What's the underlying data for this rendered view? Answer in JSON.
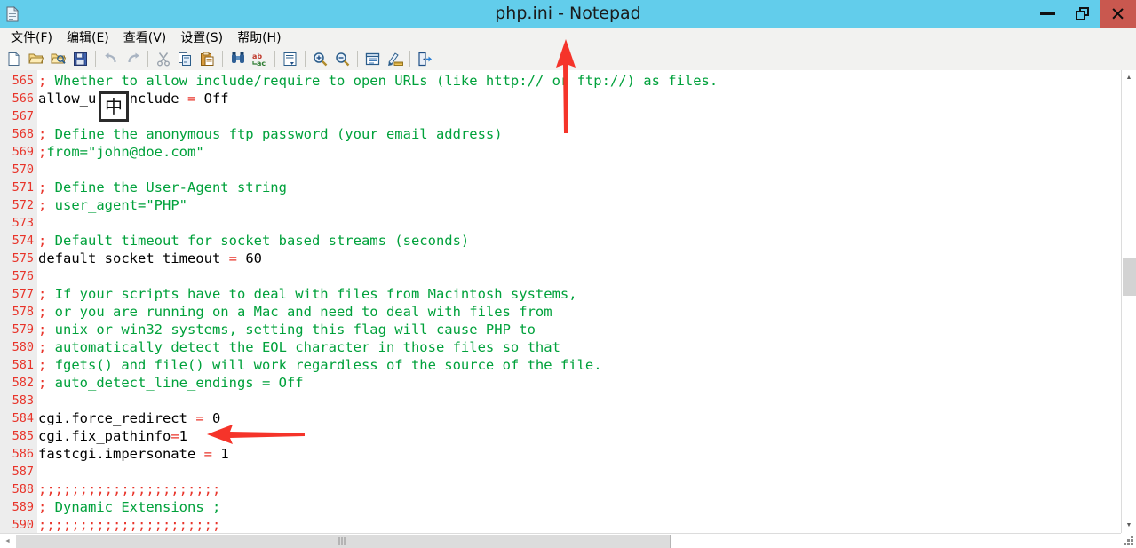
{
  "window": {
    "title": "php.ini - Notepad",
    "app_icon": "notepad-document-icon",
    "controls": {
      "minimize": "Minimize",
      "restore": "Restore",
      "close": "Close",
      "close_glyph": "✕"
    },
    "colors": {
      "titlebar": "#62cdeb",
      "close_button": "#c9584f",
      "chrome": "#f2f2f0",
      "gutter": "#ededed",
      "line_number": "#e8342a",
      "comment": "#00a13b",
      "operator": "#e8342a",
      "text": "#000000",
      "annotation_arrow": "#f5342a"
    }
  },
  "menubar": {
    "items": [
      {
        "label": "文件(F)",
        "name": "menu-file"
      },
      {
        "label": "编辑(E)",
        "name": "menu-edit"
      },
      {
        "label": "查看(V)",
        "name": "menu-view"
      },
      {
        "label": "设置(S)",
        "name": "menu-settings"
      },
      {
        "label": "帮助(H)",
        "name": "menu-help"
      }
    ]
  },
  "toolbar": {
    "buttons": [
      {
        "icon": "new-file-icon",
        "label": "新建"
      },
      {
        "icon": "open-folder-icon",
        "label": "打开"
      },
      {
        "icon": "open-recent-search-icon",
        "label": "浏览"
      },
      {
        "icon": "save-disk-icon",
        "label": "保存"
      },
      {
        "icon": "undo-arrow-icon",
        "label": "撤销"
      },
      {
        "icon": "redo-arrow-icon",
        "label": "重做"
      },
      {
        "icon": "cut-scissors-icon",
        "label": "剪切"
      },
      {
        "icon": "copy-pages-icon",
        "label": "复制"
      },
      {
        "icon": "paste-clipboard-icon",
        "label": "粘贴"
      },
      {
        "icon": "find-binoculars-icon",
        "label": "查找"
      },
      {
        "icon": "replace-abc-icon",
        "label": "替换"
      },
      {
        "icon": "goto-line-icon",
        "label": "转到"
      },
      {
        "icon": "zoom-in-icon",
        "label": "放大"
      },
      {
        "icon": "zoom-out-icon",
        "label": "缩小"
      },
      {
        "icon": "properties-list-icon",
        "label": "属性"
      },
      {
        "icon": "edit-ruler-icon",
        "label": "设置"
      },
      {
        "icon": "exit-door-icon",
        "label": "退出"
      }
    ]
  },
  "ime": {
    "indicator": "中"
  },
  "editor": {
    "first_line_number": 565,
    "lines": [
      {
        "n": "565",
        "semi": ";",
        "comment": " Whether to allow include/require to open URLs (like http:// or ftp://) as files.",
        "kind": "comment"
      },
      {
        "n": "566",
        "key": "allow_url_include",
        "op": " = ",
        "val": "Off",
        "kind": "setting"
      },
      {
        "n": "567",
        "kind": "blank"
      },
      {
        "n": "568",
        "semi": ";",
        "comment": " Define the anonymous ftp password (your email address)",
        "kind": "comment"
      },
      {
        "n": "569",
        "semi": ";",
        "comment": "from=\"john@doe.com\"",
        "kind": "comment"
      },
      {
        "n": "570",
        "kind": "blank"
      },
      {
        "n": "571",
        "semi": ";",
        "comment": " Define the User-Agent string",
        "kind": "comment"
      },
      {
        "n": "572",
        "semi": ";",
        "comment": " user_agent=\"PHP\"",
        "kind": "comment"
      },
      {
        "n": "573",
        "kind": "blank"
      },
      {
        "n": "574",
        "semi": ";",
        "comment": " Default timeout for socket based streams (seconds)",
        "kind": "comment"
      },
      {
        "n": "575",
        "key": "default_socket_timeout",
        "op": " = ",
        "val": "60",
        "kind": "setting"
      },
      {
        "n": "576",
        "kind": "blank"
      },
      {
        "n": "577",
        "semi": ";",
        "comment": " If your scripts have to deal with files from Macintosh systems,",
        "kind": "comment"
      },
      {
        "n": "578",
        "semi": ";",
        "comment": " or you are running on a Mac and need to deal with files from",
        "kind": "comment"
      },
      {
        "n": "579",
        "semi": ";",
        "comment": " unix or win32 systems, setting this flag will cause PHP to",
        "kind": "comment"
      },
      {
        "n": "580",
        "semi": ";",
        "comment": " automatically detect the EOL character in those files so that",
        "kind": "comment"
      },
      {
        "n": "581",
        "semi": ";",
        "comment": " fgets() and file() will work regardless of the source of the file.",
        "kind": "comment"
      },
      {
        "n": "582",
        "semi": ";",
        "comment": " auto_detect_line_endings = Off",
        "kind": "comment"
      },
      {
        "n": "583",
        "kind": "blank"
      },
      {
        "n": "584",
        "key": "cgi.force_redirect",
        "op": " = ",
        "val": "0",
        "kind": "setting"
      },
      {
        "n": "585",
        "key": "cgi.fix_pathinfo",
        "op": "=",
        "val": "1",
        "kind": "setting"
      },
      {
        "n": "586",
        "key": "fastcgi.impersonate",
        "op": " = ",
        "val": "1",
        "kind": "setting"
      },
      {
        "n": "587",
        "kind": "blank"
      },
      {
        "n": "588",
        "semi": ";;;;;;;;;;;;;;;;;;;;;;",
        "comment": "",
        "kind": "comment"
      },
      {
        "n": "589",
        "semi": ";",
        "comment": " Dynamic Extensions ;",
        "kind": "comment"
      },
      {
        "n": "590",
        "semi": ";;;;;;;;;;;;;;;;;;;;;;",
        "comment": "",
        "kind": "comment"
      }
    ]
  },
  "scrollbars": {
    "vertical": {
      "up": "▲",
      "down": "▼"
    },
    "horizontal": {
      "left": "◄",
      "right": "►"
    }
  },
  "annotations": [
    {
      "name": "arrow-up-annotation",
      "direction": "up",
      "color": "#f5342a"
    },
    {
      "name": "arrow-left-annotation",
      "direction": "left",
      "color": "#f5342a"
    }
  ]
}
